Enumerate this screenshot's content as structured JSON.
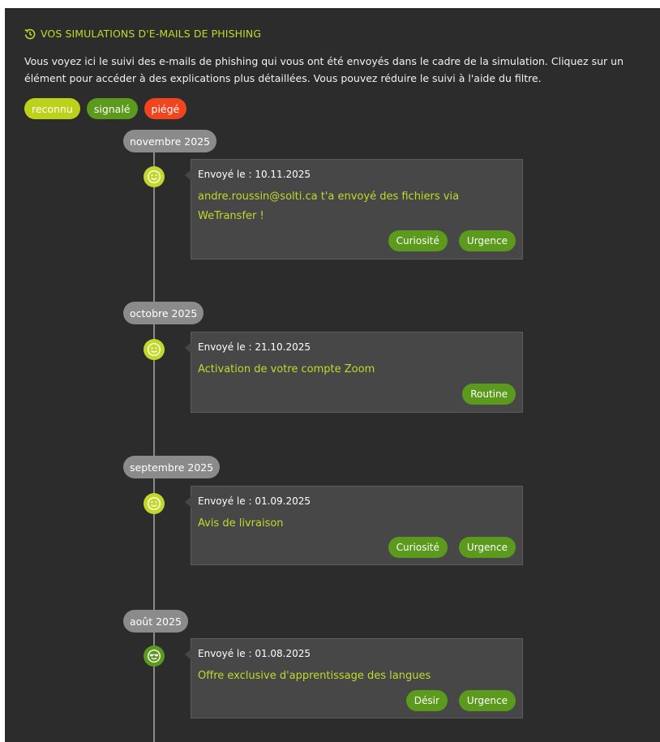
{
  "header": {
    "title": "VOS SIMULATIONS D'E-MAILS DE PHISHING",
    "intro": "Vous voyez ici le suivi des e-mails de phishing qui vous ont été envoyés dans le cadre de la simulation. Cliquez sur un élément pour accéder à des explications plus détaillées. Vous pouvez réduire le suivi à l'aide du filtre."
  },
  "filters": [
    {
      "label": "reconnu",
      "color": "#bcd21a"
    },
    {
      "label": "signalé",
      "color": "#5b9a1c"
    },
    {
      "label": "piégé",
      "color": "#f0451e"
    }
  ],
  "timeline": [
    {
      "month": "novembre 2025",
      "status_icon": "smiley-icon",
      "sent": "Envoyé le : 10.11.2025",
      "subject": "andre.roussin@solti.ca t'a envoyé des fichiers via WeTransfer !",
      "tags": [
        "Curiosité",
        "Urgence"
      ]
    },
    {
      "month": "octobre 2025",
      "status_icon": "smiley-icon",
      "sent": "Envoyé le : 21.10.2025",
      "subject": "Activation de votre compte Zoom",
      "tags": [
        "Routine"
      ]
    },
    {
      "month": "septembre 2025",
      "status_icon": "smiley-icon",
      "sent": "Envoyé le : 01.09.2025",
      "subject": "Avis de livraison",
      "tags": [
        "Curiosité",
        "Urgence"
      ]
    },
    {
      "month": "août 2025",
      "status_icon": "sunglasses-smiley-icon",
      "sent": "Envoyé le : 01.08.2025",
      "subject": "Offre exclusive d'apprentissage des langues",
      "tags": [
        "Désir",
        "Urgence"
      ]
    }
  ]
}
